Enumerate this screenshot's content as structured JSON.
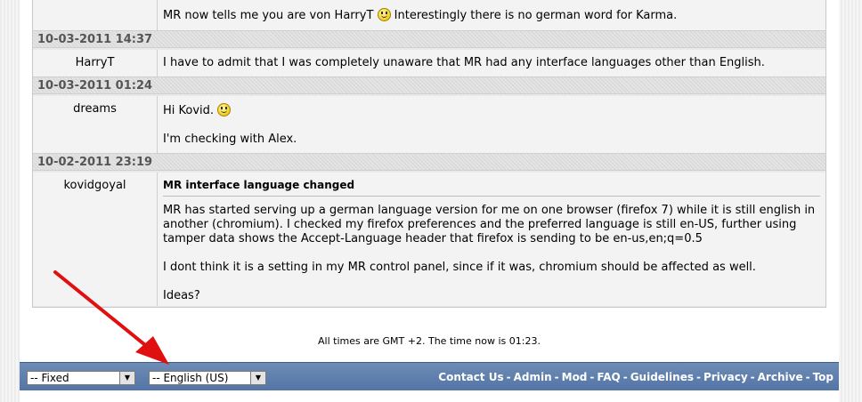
{
  "posts": [
    {
      "author": "",
      "text": "MR now tells me you are von HarryT",
      "text_after": "Interestingly there is no german word for Karma."
    },
    {
      "date": "10-03-2011 14:37",
      "author": "HarryT",
      "text": "I have to admit that I was completely unaware that MR had any interface languages other than English."
    },
    {
      "date": "10-03-2011 01:24",
      "author": "dreams",
      "line1": "Hi Kovid.",
      "line2": "I'm checking with Alex."
    },
    {
      "date": "10-02-2011 23:19",
      "author": "kovidgoyal",
      "title": "MR interface language changed",
      "para1": "MR has started serving up a german language version for me on one browser (firefox 7) while it is still english in another (chromium). I checked my firefox preferences and the preferred language is still en-US, further using tamper data shows the Accept-Language header that firefox is sending to be en-us,en;q=0.5",
      "para2": "I dont think it is a setting in my MR control panel, since if it was, chromium should be affected as well.",
      "para3": "Ideas?"
    }
  ],
  "time_note": "All times are GMT +2. The time now is 01:23.",
  "footer": {
    "style_select": "-- Fixed",
    "language_select": "-- English (US)",
    "links": [
      "Contact Us",
      "Admin",
      "Mod",
      "FAQ",
      "Guidelines",
      "Privacy",
      "Archive",
      "Top"
    ],
    "separator": "-"
  },
  "colors": {
    "footer_bar": "#5e7fb0",
    "annotation_arrow": "#e01010"
  }
}
